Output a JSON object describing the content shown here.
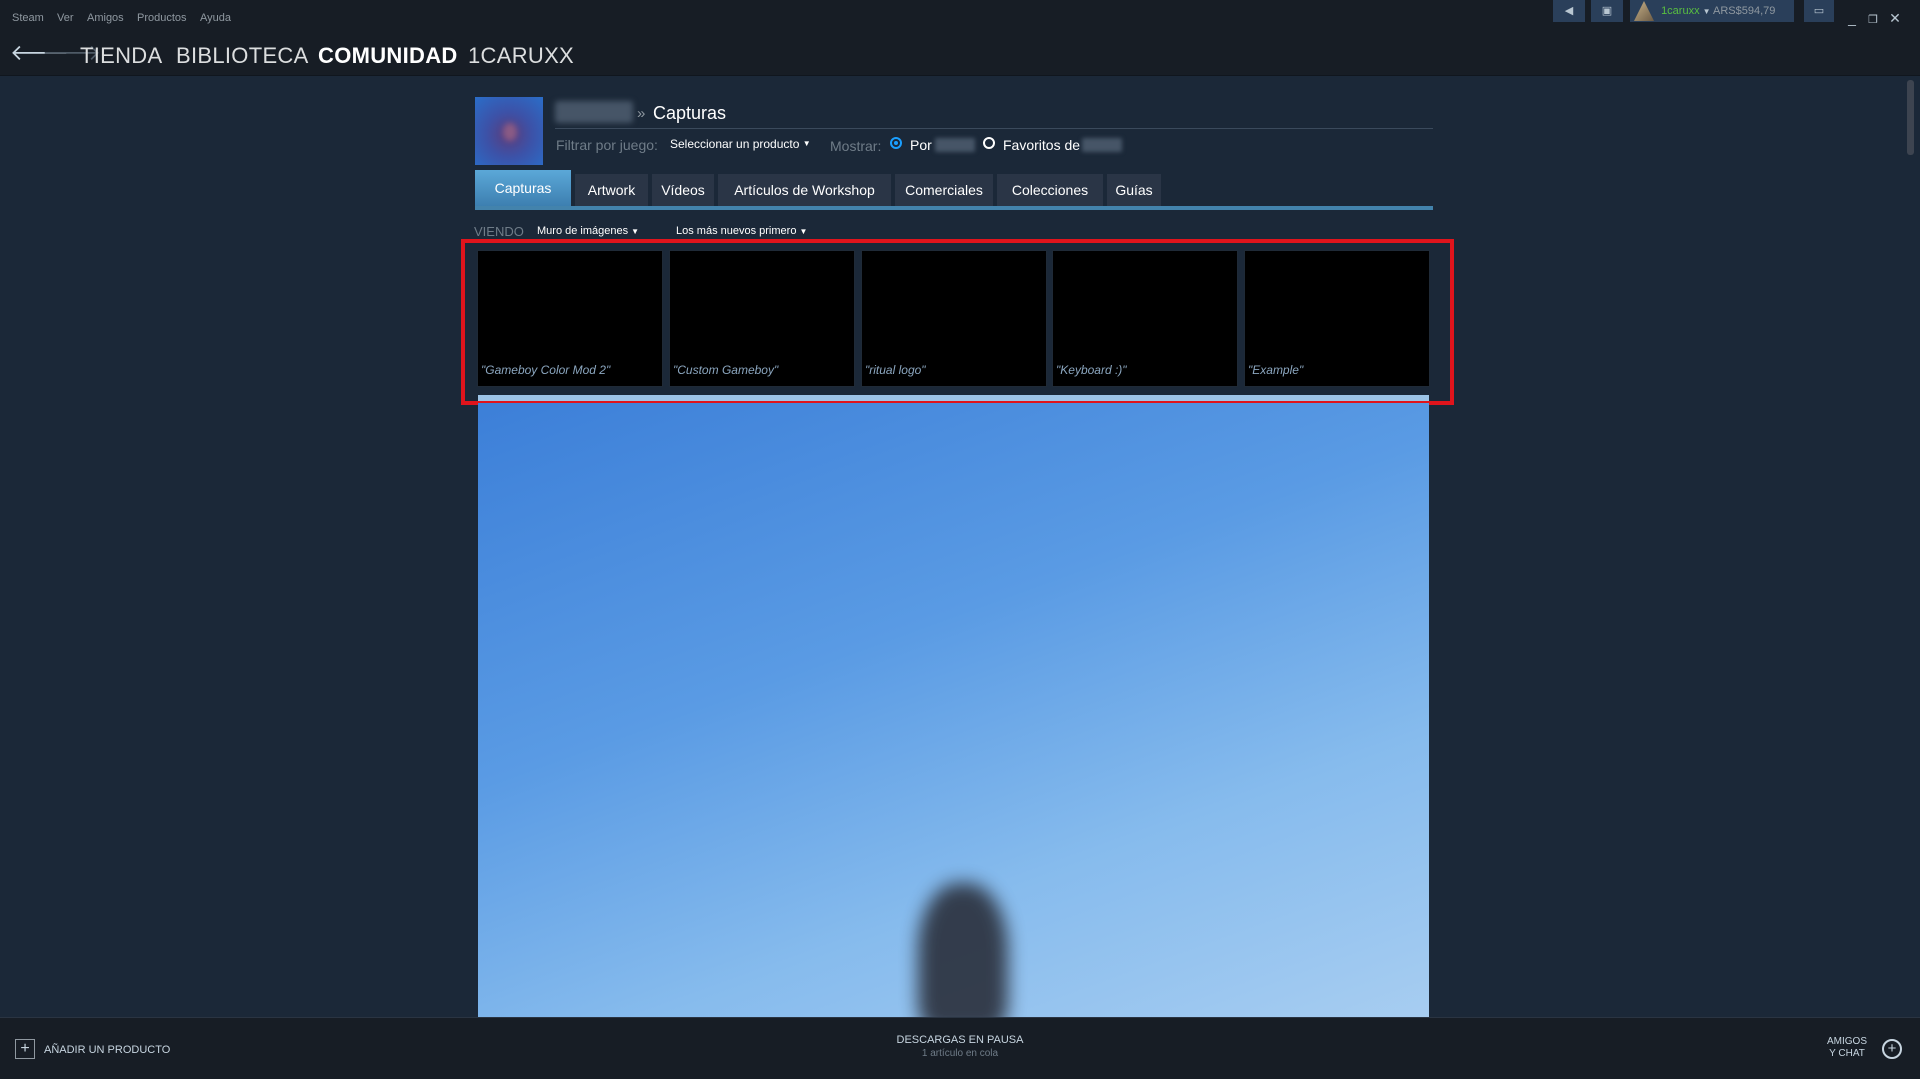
{
  "menu": {
    "items": [
      "Steam",
      "Ver",
      "Amigos",
      "Productos",
      "Ayuda"
    ]
  },
  "topright": {
    "username": "1caruxx",
    "balance": "ARS$594,79"
  },
  "nav": {
    "back_icon": "arrow-left-icon",
    "forward_icon": "arrow-right-icon",
    "links": [
      "TIENDA",
      "BIBLIOTECA",
      "COMUNIDAD",
      "1CARUXX"
    ],
    "active": "COMUNIDAD"
  },
  "profile": {
    "breadcrumb_sep": "»",
    "title": "Capturas",
    "filter_label": "Filtrar por juego:",
    "filter_value": "Seleccionar un producto",
    "show_label": "Mostrar:",
    "radio_by": "Por",
    "radio_favorites": "Favoritos de"
  },
  "tabs": [
    "Capturas",
    "Artwork",
    "Vídeos",
    "Artículos de Workshop",
    "Comerciales",
    "Colecciones",
    "Guías"
  ],
  "viewing": {
    "label": "VIENDO",
    "mode": "Muro de imágenes",
    "sort": "Los más nuevos primero"
  },
  "thumbnails": [
    {
      "title": "\"Gameboy Color Mod 2\""
    },
    {
      "title": "\"Custom Gameboy\""
    },
    {
      "title": "\"ritual logo\""
    },
    {
      "title": "\"Keyboard :)\""
    },
    {
      "title": "\"Example\""
    }
  ],
  "colors": {
    "highlight": "#e0141c",
    "accent": "#1a9fff",
    "tab_active": "#4383ac"
  },
  "bottombar": {
    "add_product": "AÑADIR UN PRODUCTO",
    "downloads_title": "DESCARGAS EN PAUSA",
    "downloads_sub": "1 artículo en cola",
    "friends_line1": "AMIGOS",
    "friends_line2": "Y CHAT"
  }
}
